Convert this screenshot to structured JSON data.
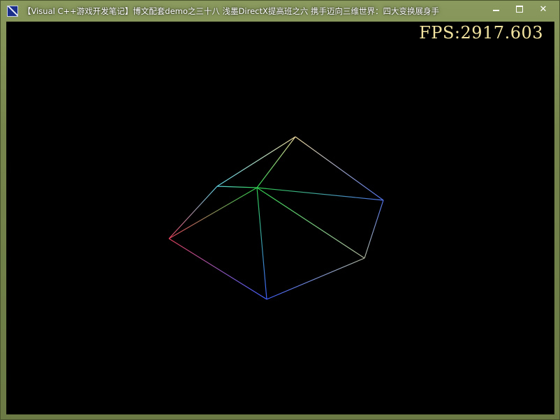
{
  "window": {
    "title": "【Visual C++游戏开发笔记】博文配套demo之三十八 浅墨DirectX提高班之六 携手迈向三维世界：四大变换展身手",
    "icon": "directx-app-icon",
    "controls": {
      "minimize": "minimize-icon",
      "maximize": "maximize-icon",
      "close": "close-icon"
    }
  },
  "hud": {
    "fps_text": "FPS:2917.603"
  },
  "scene": {
    "colors": {
      "apex": "#e8d49a",
      "top_left": "#5fd0e0",
      "left": "#e0405a",
      "bottom": "#4060ff",
      "bottom_right": "#b0b8a0",
      "right": "#5070e8",
      "center": "#30d050"
    }
  }
}
